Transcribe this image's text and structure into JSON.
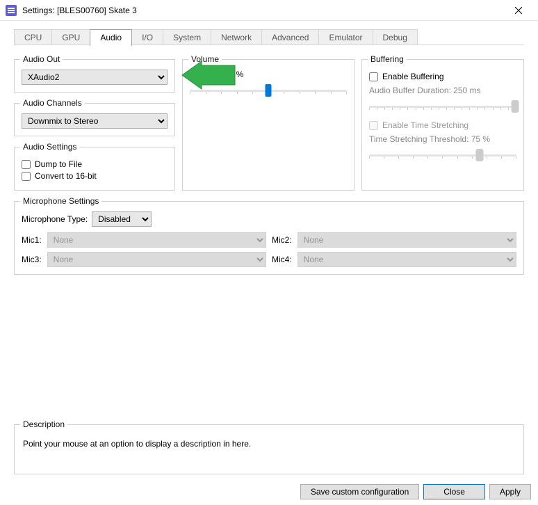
{
  "window": {
    "title": "Settings: [BLES00760] Skate 3"
  },
  "tabs": [
    "CPU",
    "GPU",
    "Audio",
    "I/O",
    "System",
    "Network",
    "Advanced",
    "Emulator",
    "Debug"
  ],
  "active_tab": "Audio",
  "audio_out": {
    "legend": "Audio Out",
    "value": "XAudio2"
  },
  "audio_channels": {
    "legend": "Audio Channels",
    "value": "Downmix to Stereo"
  },
  "audio_settings": {
    "legend": "Audio Settings",
    "dump_to_file": "Dump to File",
    "convert_16": "Convert to 16-bit"
  },
  "volume": {
    "legend": "Volume",
    "master_label": "Master: 100 %",
    "master_pct": 50
  },
  "buffering": {
    "legend": "Buffering",
    "enable_label": "Enable Buffering",
    "duration_label": "Audio Buffer Duration: 250 ms",
    "stretch_label": "Enable Time Stretching",
    "thresh_label": "Time Stretching Threshold: 75 %",
    "duration_pct": 99,
    "thresh_pct": 75
  },
  "mic": {
    "legend": "Microphone Settings",
    "type_label": "Microphone Type:",
    "type_value": "Disabled",
    "mic1": "Mic1:",
    "mic2": "Mic2:",
    "mic3": "Mic3:",
    "mic4": "Mic4:",
    "none": "None"
  },
  "description": {
    "legend": "Description",
    "text": "Point your mouse at an option to display a description in here."
  },
  "footer": {
    "save": "Save custom configuration",
    "close": "Close",
    "apply": "Apply"
  }
}
